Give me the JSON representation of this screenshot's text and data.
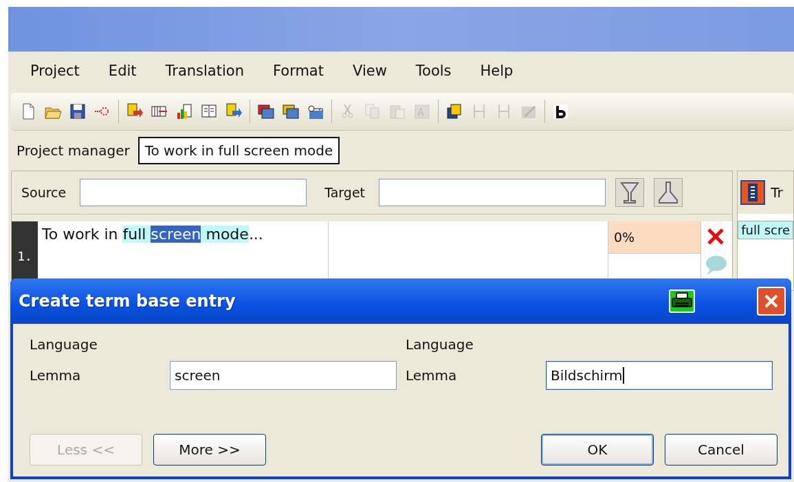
{
  "menu": [
    "Project",
    "Edit",
    "Translation",
    "Format",
    "View",
    "Tools",
    "Help"
  ],
  "toolbar": [
    {
      "disabled": false
    },
    {
      "disabled": false
    },
    {
      "disabled": false
    },
    {
      "disabled": false
    },
    {
      "disabled": false
    },
    {
      "disabled": false
    },
    {
      "disabled": false
    },
    {
      "disabled": false
    },
    {
      "disabled": false
    },
    {
      "disabled": false
    },
    {
      "disabled": false
    },
    {
      "disabled": false
    },
    {
      "disabled": true
    },
    {
      "disabled": true
    },
    {
      "disabled": true
    },
    {
      "disabled": true
    },
    {
      "disabled": false
    },
    {
      "disabled": true
    },
    {
      "disabled": true
    },
    {
      "disabled": true
    },
    {
      "disabled": false
    }
  ],
  "breadcrumb": {
    "label": "Project manager",
    "current": "To work in full screen mode"
  },
  "filter": {
    "source_label": "Source",
    "target_label": "Target"
  },
  "segments": [
    {
      "number": "1.",
      "parts": [
        {
          "text": "To work in ",
          "term": false,
          "selected": false
        },
        {
          "text": "full ",
          "term": true,
          "selected": false
        },
        {
          "text": "screen",
          "term": false,
          "selected": true
        },
        {
          "text": " mode",
          "term": true,
          "selected": false
        },
        {
          "text": "...",
          "term": false,
          "selected": false
        }
      ],
      "match": "0%"
    }
  ],
  "side_panel": {
    "title": "Tr",
    "term": "full scre"
  },
  "dialog": {
    "title": "Create term base entry",
    "columns": [
      {
        "language_label": "Language",
        "lemma_label": "Lemma",
        "lemma": "screen",
        "focused": false
      },
      {
        "language_label": "Language",
        "lemma_label": "Lemma",
        "lemma": "Bildschirm",
        "focused": true
      }
    ],
    "buttons": [
      {
        "label": "Less <<",
        "disabled": true,
        "default": false
      },
      {
        "label": "More >>",
        "disabled": false,
        "default": false
      },
      {
        "label": "OK",
        "disabled": false,
        "default": true
      },
      {
        "label": "Cancel",
        "disabled": false,
        "default": false
      }
    ]
  }
}
